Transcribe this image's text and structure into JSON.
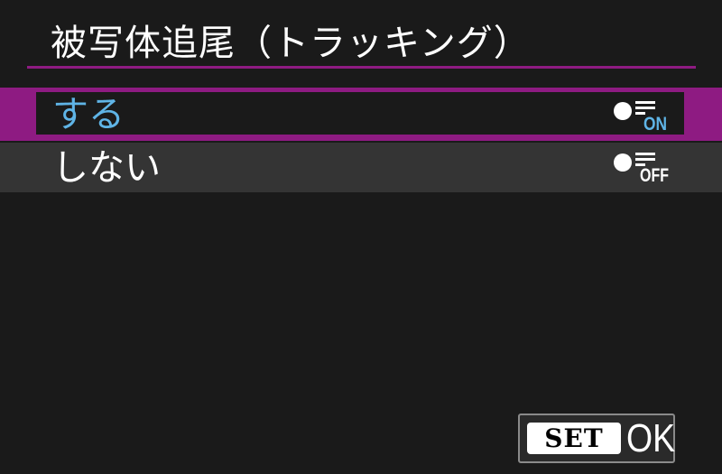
{
  "menu": {
    "title": "被写体追尾（トラッキング）",
    "options": [
      {
        "label": "する",
        "icon": "tracking-on-icon",
        "icon_text": "ON",
        "selected": true
      },
      {
        "label": "しない",
        "icon": "tracking-off-icon",
        "icon_text": "OFF",
        "selected": false
      }
    ]
  },
  "footer": {
    "set_label": "SET",
    "ok_label": "OK"
  },
  "colors": {
    "background": "#1a1a1a",
    "accent": "#8e1b82",
    "selected_text": "#5fb4e6",
    "unselected_row": "#343434",
    "text": "#ffffff"
  }
}
